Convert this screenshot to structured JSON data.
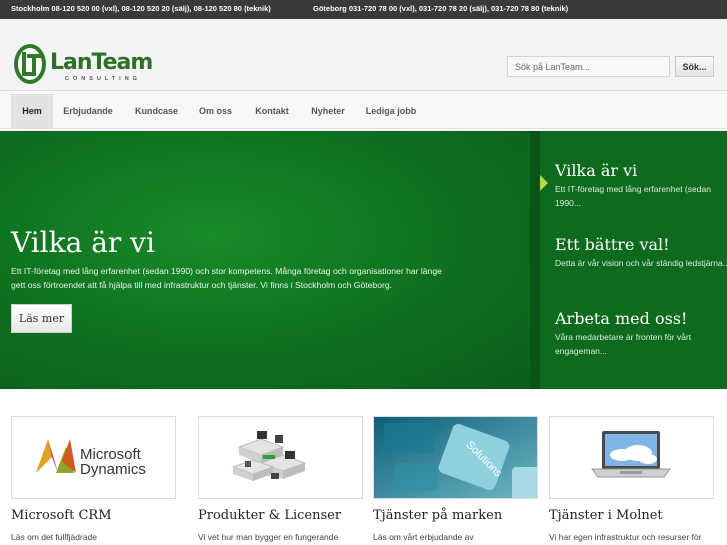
{
  "topbar": {
    "stockholm": "Stockholm 08-120 520 00 (vxl), 08-120 520 20 (sälj), 08-120 520 80 (teknik)",
    "goteborg": "Göteborg  031-720 78 00 (vxl), 031-720 78 20 (sälj), 031-720 78 80 (teknik)"
  },
  "logo": {
    "name": "LanTeam",
    "tagline": "CONSULTING"
  },
  "search": {
    "placeholder": "Sök på LanTeam...",
    "button": "Sök..."
  },
  "nav": {
    "items": [
      {
        "label": "Hem"
      },
      {
        "label": "Erbjudande"
      },
      {
        "label": "Kundcase"
      },
      {
        "label": "Om oss"
      },
      {
        "label": "Kontakt"
      },
      {
        "label": "Nyheter"
      },
      {
        "label": "Lediga jobb"
      }
    ],
    "active": "Hem"
  },
  "hero": {
    "title": "Vilka är vi",
    "text": "Ett IT-företag med lång erfarenhet (sedan 1990) och stor kompetens. Många företag och organisationer har länge gett oss förtroendet att få hjälpa till med infrastruktur och tjänster. Vi finns i Stockholm och Göteborg.",
    "button": "Läs mer"
  },
  "side": {
    "items": [
      {
        "title": "Vilka är vi",
        "text": "Ett IT-företag med lång erfarenhet (sedan 1990..."
      },
      {
        "title": "Ett bättre val!",
        "text": "Detta är vår vision och vår ständig ledstjärna..."
      },
      {
        "title": "Arbeta med oss!",
        "text": "Våra medarbetare är fronten för vårt engageman..."
      }
    ]
  },
  "cards": [
    {
      "title": "Microsoft CRM",
      "text": "Läs om det fullfjädrade",
      "image_text": [
        "Microsoft",
        "Dynamics"
      ]
    },
    {
      "title": "Produkter & Licenser",
      "text": "Vi vet hur man bygger en fungerande"
    },
    {
      "title": "Tjänster på marken",
      "text": "Läs om vårt erbjudande av",
      "image_text": [
        "Solutions"
      ]
    },
    {
      "title": "Tjänster i Molnet",
      "text": "Vi har egen infrastruktur och resurser för"
    }
  ],
  "colors": {
    "brand_green": "#0f7420",
    "topbar": "#3a3a3a",
    "accent": "#b5d84b"
  }
}
